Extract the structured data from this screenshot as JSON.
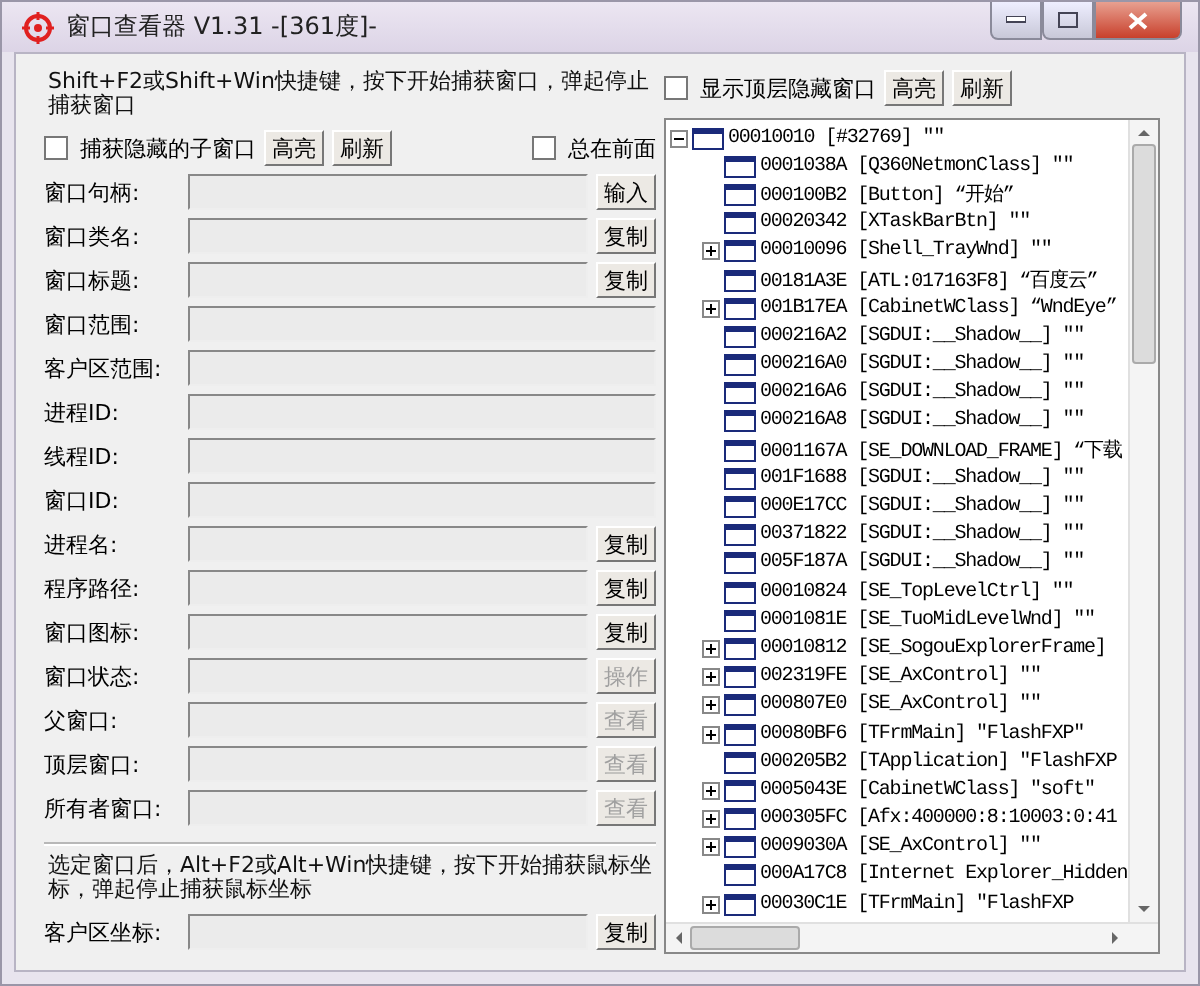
{
  "window": {
    "title": "窗口查看器 V1.31 -[361度]-"
  },
  "left": {
    "hint": "Shift+F2或Shift+Win快捷键，按下开始捕获窗口，弹起停止捕获窗口",
    "capture_hidden": {
      "label": "捕获隐藏的子窗口",
      "checked": false
    },
    "buttons": [
      {
        "label": "高亮"
      },
      {
        "label": "刷新"
      }
    ],
    "always_on_top": {
      "label": "总在前面",
      "checked": false
    },
    "fields": [
      {
        "label": "窗口句柄:",
        "button": {
          "label": "输入",
          "disabled": false
        }
      },
      {
        "label": "窗口类名:",
        "button": {
          "label": "复制",
          "disabled": false
        }
      },
      {
        "label": "窗口标题:",
        "button": {
          "label": "复制",
          "disabled": false
        }
      },
      {
        "label": "窗口范围:"
      },
      {
        "label": "客户区范围:"
      },
      {
        "label": "进程ID:"
      },
      {
        "label": "线程ID:"
      },
      {
        "label": "窗口ID:"
      },
      {
        "label": "进程名:",
        "button": {
          "label": "复制",
          "disabled": false
        }
      },
      {
        "label": "程序路径:",
        "button": {
          "label": "复制",
          "disabled": false
        }
      },
      {
        "label": "窗口图标:",
        "button": {
          "label": "复制",
          "disabled": false
        }
      },
      {
        "label": "窗口状态:",
        "button": {
          "label": "操作",
          "disabled": true
        }
      },
      {
        "label": "父窗口:",
        "button": {
          "label": "查看",
          "disabled": true
        }
      },
      {
        "label": "顶层窗口:",
        "button": {
          "label": "查看",
          "disabled": true
        }
      },
      {
        "label": "所有者窗口:",
        "button": {
          "label": "查看",
          "disabled": true
        }
      }
    ],
    "hint2": "选定窗口后，Alt+F2或Alt+Win快捷键，按下开始捕获鼠标坐标，弹起停止捕获鼠标坐标",
    "coord_field": {
      "label": "客户区坐标:",
      "button": {
        "label": "复制",
        "disabled": false
      }
    }
  },
  "right": {
    "show_hidden": {
      "label": "显示顶层隐藏窗口",
      "checked": false
    },
    "buttons": [
      {
        "label": "高亮"
      },
      {
        "label": "刷新"
      }
    ],
    "tree": {
      "text": "00010010 [#32769] \"\"",
      "expanded": true,
      "children": [
        {
          "text": "0001038A [Q360NetmonClass] \"\""
        },
        {
          "text": "000100B2 [Button] “开始”"
        },
        {
          "text": "00020342 [XTaskBarBtn] \"\""
        },
        {
          "text": "00010096 [Shell_TrayWnd] \"\"",
          "expanded": false
        },
        {
          "text": "00181A3E [ATL:017163F8] “百度云”"
        },
        {
          "text": "001B17EA [CabinetWClass] “WndEye”",
          "expanded": false
        },
        {
          "text": "000216A2 [SGDUI:__Shadow__] \"\""
        },
        {
          "text": "000216A0 [SGDUI:__Shadow__] \"\""
        },
        {
          "text": "000216A6 [SGDUI:__Shadow__] \"\""
        },
        {
          "text": "000216A8 [SGDUI:__Shadow__] \"\""
        },
        {
          "text": "0001167A [SE_DOWNLOAD_FRAME] “下载"
        },
        {
          "text": "001F1688 [SGDUI:__Shadow__] \"\""
        },
        {
          "text": "000E17CC [SGDUI:__Shadow__] \"\""
        },
        {
          "text": "00371822 [SGDUI:__Shadow__] \"\""
        },
        {
          "text": "005F187A [SGDUI:__Shadow__] \"\""
        },
        {
          "text": "00010824 [SE_TopLevelCtrl] \"\""
        },
        {
          "text": "0001081E [SE_TuoMidLevelWnd] \"\""
        },
        {
          "text": "00010812 [SE_SogouExplorerFrame]",
          "expanded": false
        },
        {
          "text": "002319FE [SE_AxControl] \"\"",
          "expanded": false
        },
        {
          "text": "000807E0 [SE_AxControl] \"\"",
          "expanded": false
        },
        {
          "text": "00080BF6 [TFrmMain] \"FlashFXP\"",
          "expanded": false
        },
        {
          "text": "000205B2 [TApplication] \"FlashFXP"
        },
        {
          "text": "0005043E [CabinetWClass] \"soft\"",
          "expanded": false
        },
        {
          "text": "000305FC [Afx:400000:8:10003:0:41",
          "expanded": false
        },
        {
          "text": "0009030A [SE_AxControl] \"\"",
          "expanded": false
        },
        {
          "text": "000A17C8 [Internet Explorer_Hidden"
        },
        {
          "text": "00030C1E [TFrmMain] \"FlashFXP",
          "expanded": false
        }
      ]
    }
  }
}
